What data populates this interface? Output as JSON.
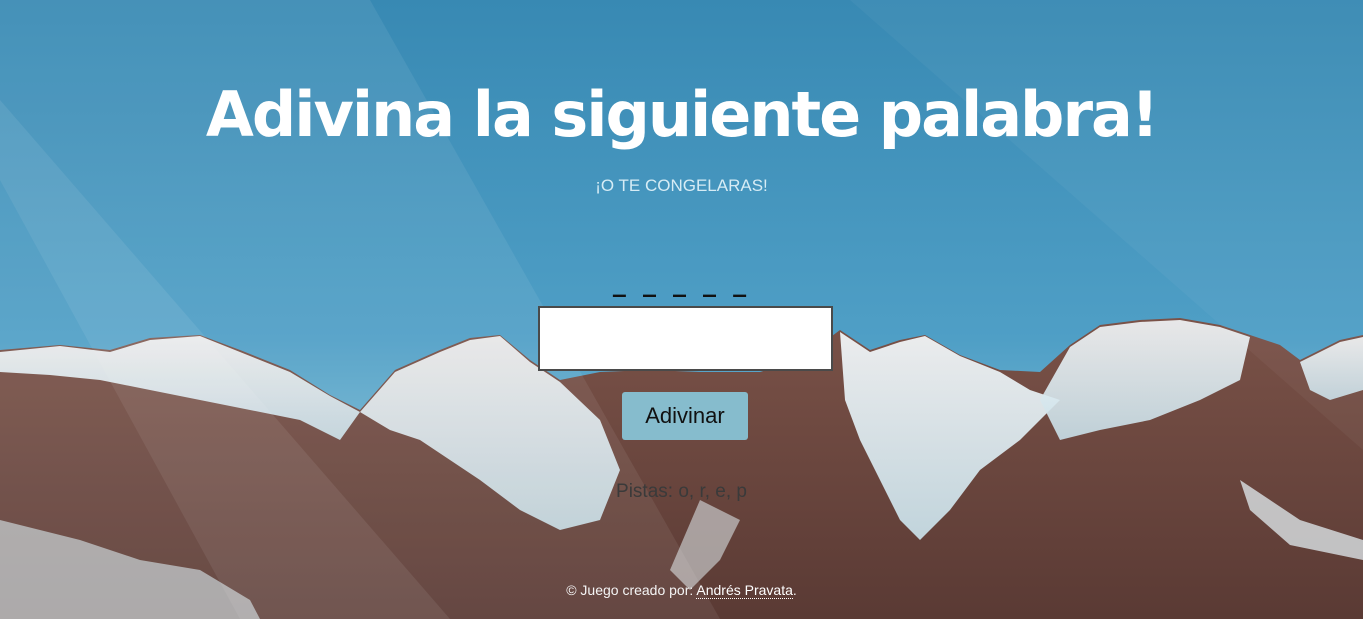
{
  "header": {
    "title": "Adivina la siguiente palabra!",
    "subtitle": "¡O TE CONGELARAS!"
  },
  "game": {
    "word_display": "_ _ _ _ _",
    "input_value": "",
    "button_label": "Adivinar",
    "hints_text": "Pistas: o, r, e, p"
  },
  "footer": {
    "prefix": "© Juego creado por:",
    "author": "Andrés Pravata",
    "suffix": "."
  }
}
